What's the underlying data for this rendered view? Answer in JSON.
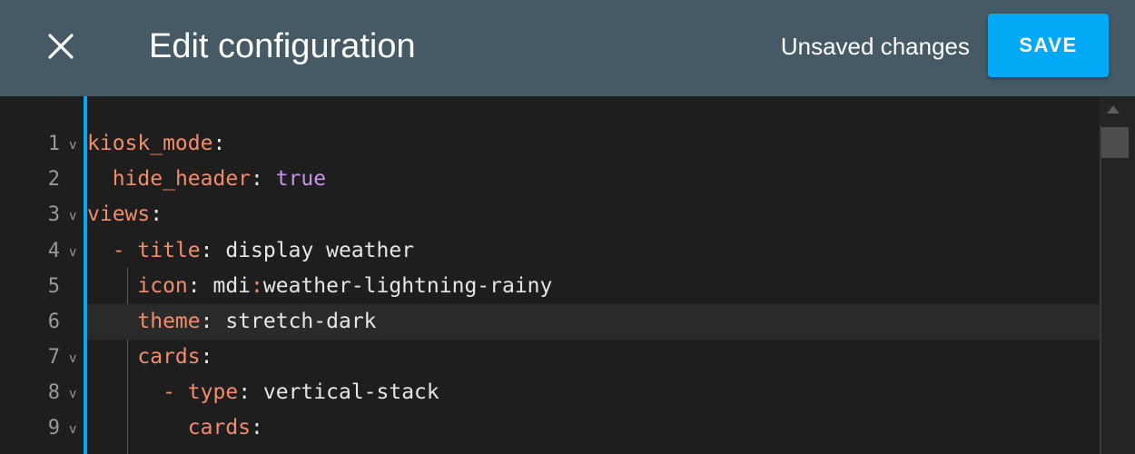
{
  "dialog": {
    "close_icon": "close-icon",
    "title": "Edit configuration",
    "status": "Unsaved changes",
    "save_label": "SAVE",
    "accent_color": "#03a9f4",
    "header_color": "#455a64"
  },
  "editor": {
    "active_line": 6,
    "fold_marker": "v",
    "lines": [
      {
        "number": "1",
        "fold": "v"
      },
      {
        "number": "2",
        "fold": ""
      },
      {
        "number": "3",
        "fold": "v"
      },
      {
        "number": "4",
        "fold": "v"
      },
      {
        "number": "5",
        "fold": ""
      },
      {
        "number": "6",
        "fold": ""
      },
      {
        "number": "7",
        "fold": "v"
      },
      {
        "number": "8",
        "fold": "v"
      },
      {
        "number": "9",
        "fold": "v"
      }
    ],
    "code": {
      "l1": {
        "key": "kiosk_mode",
        "colon": ":"
      },
      "l2": {
        "indent": "  ",
        "key": "hide_header",
        "colon": ":",
        "value": " true"
      },
      "l3": {
        "key": "views",
        "colon": ":"
      },
      "l4": {
        "indent": "  ",
        "dash": "- ",
        "key": "title",
        "colon": ":",
        "value": " display weather"
      },
      "l5": {
        "indent": "    ",
        "key": "icon",
        "colon": ":",
        "value_a": " mdi",
        "value_sep": ":",
        "value_b": "weather-lightning-rainy"
      },
      "l6": {
        "indent": "    ",
        "key": "theme",
        "colon": ":",
        "value": " stretch-dark"
      },
      "l7": {
        "indent": "    ",
        "key": "cards",
        "colon": ":"
      },
      "l8": {
        "indent": "      ",
        "dash": "- ",
        "key": "type",
        "colon": ":",
        "value": " vertical-stack"
      },
      "l9": {
        "indent": "        ",
        "key": "cards",
        "colon": ":"
      }
    }
  }
}
